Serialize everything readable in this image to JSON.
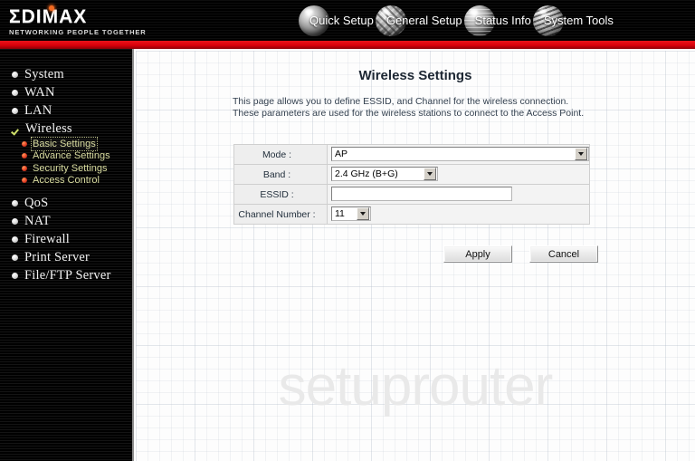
{
  "brand": {
    "logo_text": "ΣDIMAX",
    "tagline": "NETWORKING PEOPLE TOGETHER"
  },
  "topnav": {
    "items": [
      {
        "label": "Quick Setup",
        "icon": "globe-orb-icon"
      },
      {
        "label": "General Setup",
        "icon": "globe-grid-orb-icon"
      },
      {
        "label": "Status Info",
        "icon": "globe-lines-orb-icon"
      },
      {
        "label": "System Tools",
        "icon": "globe-bars-orb-icon"
      }
    ]
  },
  "sidebar": {
    "items": [
      {
        "label": "System",
        "icon": "bullet-icon",
        "selected": false
      },
      {
        "label": "WAN",
        "icon": "bullet-icon",
        "selected": false
      },
      {
        "label": "LAN",
        "icon": "bullet-icon",
        "selected": false
      },
      {
        "label": "Wireless",
        "icon": "check-icon",
        "selected": true
      },
      {
        "label": "QoS",
        "icon": "bullet-icon",
        "selected": false
      },
      {
        "label": "NAT",
        "icon": "bullet-icon",
        "selected": false
      },
      {
        "label": "Firewall",
        "icon": "bullet-icon",
        "selected": false
      },
      {
        "label": "Print Server",
        "icon": "bullet-icon",
        "selected": false
      },
      {
        "label": "File/FTP Server",
        "icon": "bullet-icon",
        "selected": false
      }
    ],
    "wireless_subitems": [
      {
        "label": "Basic Settings",
        "selected": true
      },
      {
        "label": "Advance Settings",
        "selected": false
      },
      {
        "label": "Security Settings",
        "selected": false
      },
      {
        "label": "Access Control",
        "selected": false
      }
    ]
  },
  "main": {
    "title": "Wireless Settings",
    "description": "This page allows you to define ESSID, and Channel for the wireless connection. These parameters are used for the wireless stations to connect to the Access Point.",
    "watermark": "setuprouter",
    "form": {
      "mode": {
        "label": "Mode :",
        "value": "AP",
        "control": "select"
      },
      "band": {
        "label": "Band :",
        "value": "2.4 GHz (B+G)",
        "control": "select"
      },
      "essid": {
        "label": "ESSID :",
        "value": "",
        "placeholder": "",
        "control": "text"
      },
      "channel": {
        "label": "Channel Number :",
        "value": "11",
        "control": "select"
      }
    },
    "buttons": {
      "apply": "Apply",
      "cancel": "Cancel"
    }
  },
  "colors": {
    "accent_red": "#d9000a",
    "logo_dot_orange": "#f26a21",
    "sidebar_bg": "#000000",
    "sub_item_text": "#d9dca0",
    "watermark": "#e9e9e9"
  }
}
